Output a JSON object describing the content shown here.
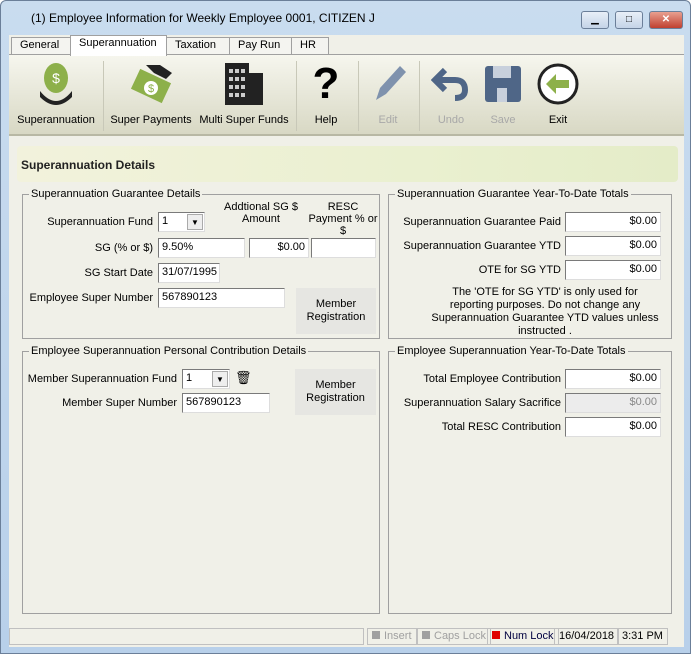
{
  "window": {
    "title": "(1) Employee Information for Weekly Employee 0001, CITIZEN J",
    "minimize": "▁",
    "maximize": "□",
    "close": "✕"
  },
  "tabs": [
    {
      "label": "General"
    },
    {
      "label": "Superannuation"
    },
    {
      "label": "Taxation"
    },
    {
      "label": "Pay Run"
    },
    {
      "label": "HR"
    }
  ],
  "toolbar": {
    "superannuation": "Superannuation",
    "super_payments": "Super Payments",
    "multi_super_funds": "Multi Super Funds",
    "help": "Help",
    "edit": "Edit",
    "undo": "Undo",
    "save": "Save",
    "exit": "Exit"
  },
  "page_title": "Superannuation Details",
  "sg_details": {
    "legend": "Superannuation Guarantee Details",
    "fund_label": "Superannuation Fund",
    "fund_value": "1",
    "additional_label": "Addtional SG $ Amount",
    "resc_label": "RESC Payment % or $",
    "sg_label": "SG (% or $)",
    "sg_value": "9.50%",
    "additional_value": "$0.00",
    "resc_value": "",
    "start_label": "SG Start Date",
    "start_value": "31/07/1995",
    "number_label": "Employee Super Number",
    "number_value": "567890123",
    "member_reg": "Member Registration"
  },
  "sg_ytd": {
    "legend": "Superannuation Guarantee Year-To-Date Totals",
    "paid_label": "Superannuation Guarantee Paid",
    "paid_value": "$0.00",
    "ytd_label": "Superannuation Guarantee YTD",
    "ytd_value": "$0.00",
    "ote_label": "OTE for SG YTD",
    "ote_value": "$0.00",
    "note": "The 'OTE for SG YTD' is only used for reporting purposes. Do not change any Superannuation Guarantee YTD values unless instructed ."
  },
  "personal": {
    "legend": "Employee Superannuation Personal Contribution Details",
    "fund_label": "Member Superannuation Fund",
    "fund_value": "1",
    "number_label": "Member Super Number",
    "number_value": "567890123",
    "member_reg": "Member Registration"
  },
  "emp_ytd": {
    "legend": "Employee Superannuation Year-To-Date Totals",
    "total_label": "Total Employee Contribution",
    "total_value": "$0.00",
    "sacrifice_label": "Superannuation Salary Sacrifice",
    "sacrifice_value": "$0.00",
    "resc_label": "Total RESC Contribution",
    "resc_value": "$0.00"
  },
  "status": {
    "insert": "Insert",
    "caps": "Caps Lock",
    "num": "Num Lock",
    "date": "16/04/2018",
    "time": "3:31 PM"
  }
}
